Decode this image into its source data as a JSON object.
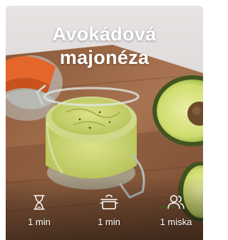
{
  "recipe": {
    "title_line1": "Avokádová",
    "title_line2": "majonéza"
  },
  "meta": {
    "prep_time": "1 min",
    "cook_time": "1 min",
    "servings": "1 miska"
  },
  "icons": {
    "prep": "hourglass-icon",
    "cook": "pot-icon",
    "servings": "people-icon"
  }
}
